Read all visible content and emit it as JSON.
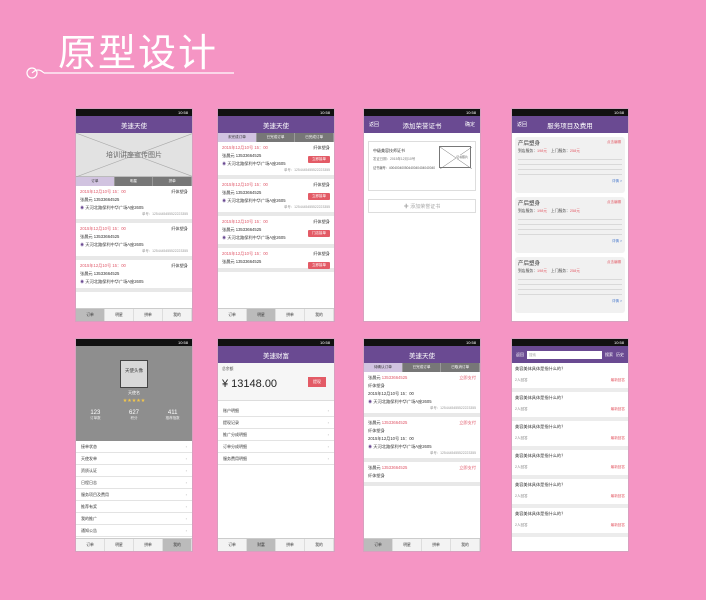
{
  "page_title": "原型设计",
  "status_time": "10:58",
  "screens": {
    "orders_banner": {
      "nav_title": "美速天使",
      "banner_text": "培训讲座宣传图片",
      "tabs": [
        "订单",
        "明星",
        "拼单"
      ],
      "cards": [
        {
          "date": "2015年12月10号  15：00",
          "service": "纤体塑身",
          "name": "张晨元",
          "phone": "13533664525",
          "addr": "天河北路保利中华广场A座2605",
          "order_no": "单号：1254445455522223355"
        },
        {
          "date": "2015年12月10号  15：00",
          "service": "纤体塑身",
          "name": "张晨元",
          "phone": "13533664525",
          "addr": "天河北路保利中华广场A座2605",
          "order_no": "单号：1254445455522223355"
        },
        {
          "date": "2015年12月10号  15：00",
          "service": "纤体塑身",
          "name": "张晨元",
          "phone": "13533664525",
          "addr": "天河北路保利中华广场A座2605",
          "order_no": "单号：1254445455522223355"
        }
      ],
      "bottom_tabs": [
        "订单",
        "明星",
        "拼单",
        "我的"
      ]
    },
    "orders_list": {
      "nav_title": "美速天使",
      "tabs": [
        "未完成订单",
        "已完成订单",
        "已完成订单"
      ],
      "cards": [
        {
          "date": "2015年12月10号  15：00",
          "service": "纤体塑身",
          "name": "张晨元",
          "phone": "13533664525",
          "addr": "天河北路保利中华广场A座2605",
          "order_no": "单号：1254445455522223355",
          "btn": "立即接单"
        },
        {
          "date": "2015年12月10号  15：00",
          "service": "纤体塑身",
          "name": "张晨元",
          "phone": "13533664525",
          "addr": "天河北路保利中华广场A座2605",
          "order_no": "单号：1254445455522223355",
          "btn": "立即接单"
        },
        {
          "date": "2015年12月10号  15：00",
          "service": "纤体塑身",
          "name": "张晨元",
          "phone": "13533664525",
          "addr": "天河北路保利中华广场A座2605",
          "order_no": "单号：1254445455522223355",
          "btn": "门店接单"
        },
        {
          "date": "2015年12月10号  15：00",
          "service": "纤体塑身",
          "name": "张晨元",
          "phone": "13533664525",
          "addr": "天河北路保利中华广场A座2605",
          "order_no": "单号：1254445455522223355",
          "btn": "立即接单"
        }
      ],
      "bottom_tabs": [
        "订单",
        "明星",
        "拼单",
        "我的"
      ]
    },
    "certificate": {
      "nav_back": "返回",
      "nav_title": "添加荣誉证书",
      "nav_confirm": "确定",
      "cert_name": "中级美容技师证书",
      "cert_date": "发证日期：2015年12月10号",
      "cert_no": "证书编号：40040040050440040404040040",
      "cert_img": "证书照片",
      "add_label": "添加荣誉证书"
    },
    "services": {
      "nav_back": "返回",
      "nav_title": "服务项目及费用",
      "items": [
        {
          "title": "产后塑身",
          "edit": "点击编辑",
          "fee_label": "到店服务",
          "fee": "198元",
          "home_label": "上门服务",
          "home_fee": "258元",
          "more": "详情 >"
        },
        {
          "title": "产后塑身",
          "edit": "点击编辑",
          "fee_label": "到店服务",
          "fee": "198元",
          "home_label": "上门服务",
          "home_fee": "258元",
          "more": "详情 >"
        },
        {
          "title": "产后塑身",
          "edit": "点击编辑",
          "fee_label": "到店服务",
          "fee": "198元",
          "home_label": "上门服务",
          "home_fee": "258元",
          "more": "详情 >"
        }
      ]
    },
    "profile": {
      "avatar_text": "天使头像",
      "name": "天使名",
      "stars": "★★★★★",
      "stats": [
        {
          "value": "123",
          "label": "订单数"
        },
        {
          "value": "627",
          "label": "积分"
        },
        {
          "value": "411",
          "label": "推荐指数"
        }
      ],
      "menu": [
        "接单状态",
        "天使发单",
        "资质认证",
        "日程日志",
        "服务项目及费用",
        "推荐有奖",
        "我的推广",
        "通知公告"
      ],
      "bottom_tabs": [
        "订单",
        "明星",
        "拼单",
        "我的"
      ]
    },
    "wallet": {
      "nav_title": "美速财富",
      "balance_label": "总余额",
      "balance": "¥ 13148.00",
      "withdraw": "提现",
      "menu": [
        "账户明细",
        "提现记录",
        "推广分成明细",
        "订单分成明细",
        "服务费用明细"
      ],
      "bottom_tabs": [
        "订单",
        "财富",
        "拼单",
        "我的"
      ]
    },
    "orders_pending": {
      "nav_title": "美速天使",
      "tabs": [
        "待确认订单",
        "已完成订单",
        "已取消订单"
      ],
      "cards": [
        {
          "name": "张晨元",
          "phone": "13533664525",
          "service": "纤体塑身",
          "date": "2015年12月10号  15：00",
          "addr": "天河北路保利中华广场A座2605",
          "order_no": "单号：1254445455522223355",
          "status": "立即支付"
        },
        {
          "name": "张晨元",
          "phone": "13533664525",
          "service": "纤体塑身",
          "date": "2015年12月10号  15：00",
          "addr": "天河北路保利中华广场A座2605",
          "order_no": "单号：1254445455522223355",
          "status": "立即支付"
        },
        {
          "name": "张晨元",
          "phone": "13533664525",
          "service": "纤体塑身",
          "date": "2015年12月10号  15：00",
          "addr": "天河北路保利中华广场A座2605",
          "order_no": "单号：1254445455522223355",
          "status": "立即支付"
        }
      ],
      "bottom_tabs": [
        "订单",
        "明星",
        "拼单",
        "我的"
      ]
    },
    "faq": {
      "nav_back": "返回",
      "search_placeholder": "搜索",
      "search_btn": "搜索",
      "history": "历史",
      "items": [
        {
          "q": "美容美体具体是指什么的？",
          "a": "2人回答",
          "tag": "最新回答"
        },
        {
          "q": "美容美体具体是指什么的？",
          "a": "2人回答",
          "tag": "最新回答"
        },
        {
          "q": "美容美体具体是指什么的？",
          "a": "2人回答",
          "tag": "最新回答"
        },
        {
          "q": "美容美体具体是指什么的？",
          "a": "2人回答",
          "tag": "最新回答"
        },
        {
          "q": "美容美体具体是指什么的？",
          "a": "2人回答",
          "tag": "最新回答"
        },
        {
          "q": "美容美体具体是指什么的？",
          "a": "2人回答",
          "tag": "最新回答"
        }
      ]
    }
  }
}
